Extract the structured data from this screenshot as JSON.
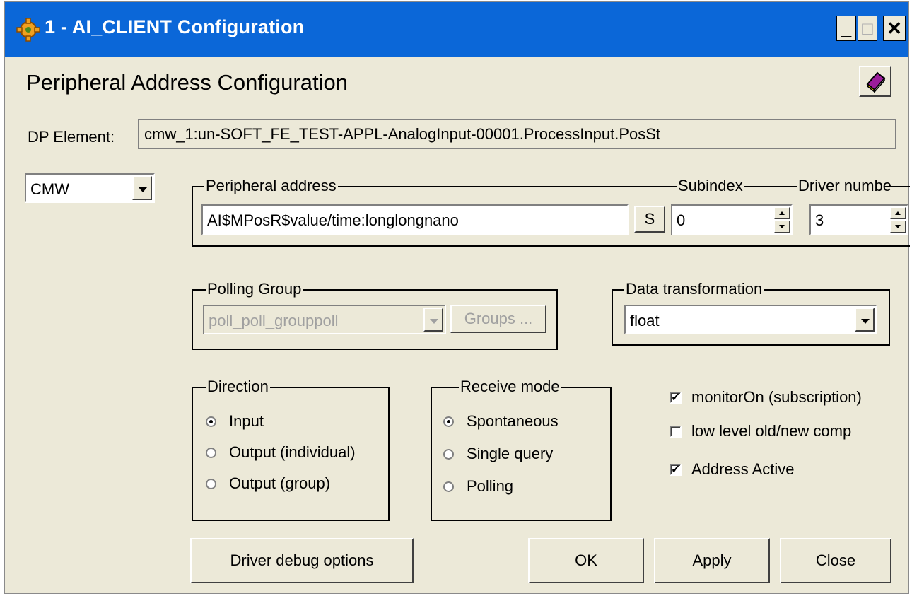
{
  "window": {
    "title": "1 - AI_CLIENT Configuration",
    "min_glyph": "_",
    "max_glyph": "□",
    "close_glyph": "✕",
    "title_icon": "gear-icon",
    "help_icon": "help-book-icon"
  },
  "heading": "Peripheral Address Configuration",
  "dp_element": {
    "label": "DP Element:",
    "value": "cmw_1:un-SOFT_FE_TEST-APPL-AnalogInput-00001.ProcessInput.PosSt"
  },
  "driver_type": {
    "value": "CMW"
  },
  "peripheral": {
    "label": "Peripheral address",
    "value": "AI$MPosR$value/time:longlongnano",
    "s_button": "S",
    "subindex_label": "Subindex",
    "subindex_value": "0",
    "driver_label": "Driver numbe",
    "driver_value": "3"
  },
  "polling_group": {
    "label": "Polling Group",
    "value": "poll_poll_grouppoll",
    "groups_button": "Groups ..."
  },
  "data_transformation": {
    "label": "Data transformation",
    "value": "float"
  },
  "direction": {
    "label": "Direction",
    "options": [
      "Input",
      "Output (individual)",
      "Output (group)"
    ],
    "selected": "Input"
  },
  "receive_mode": {
    "label": "Receive mode",
    "options": [
      "Spontaneous",
      "Single query",
      "Polling"
    ],
    "selected": "Spontaneous"
  },
  "checkboxes": [
    {
      "label": "monitorOn (subscription)",
      "checked": true
    },
    {
      "label": "low level old/new comp",
      "checked": false
    },
    {
      "label": "Address Active",
      "checked": true
    }
  ],
  "buttons": {
    "driver_debug": "Driver debug options",
    "ok": "OK",
    "apply": "Apply",
    "close": "Close"
  }
}
